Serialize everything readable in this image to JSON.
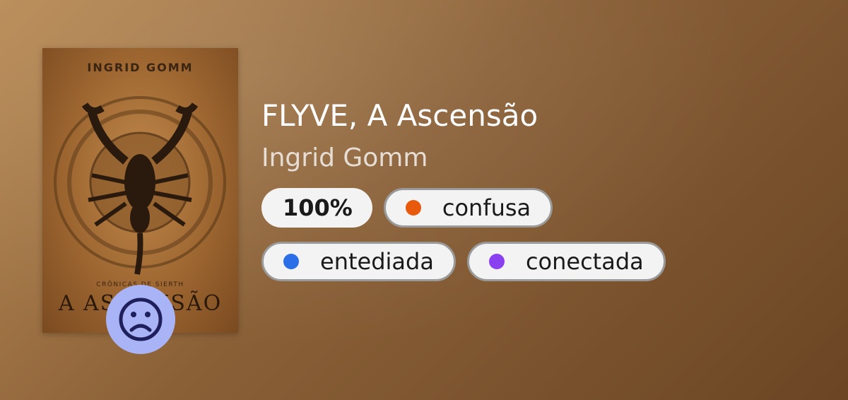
{
  "colors": {
    "background_start": "#b98b55",
    "background_end": "#6b4524",
    "mood_badge": "#a9b4f6",
    "emotion_confusa": "#e8590c",
    "emotion_entediada": "#2b6fe8",
    "emotion_conectada": "#8a3ff0"
  },
  "cover": {
    "author_text": "INGRID GOMM",
    "series_text": "CRÔNICAS DE SIERTH",
    "title_text": "A ASCENSÃO"
  },
  "book": {
    "title": "FLYVE, A Ascensão",
    "author": "Ingrid Gomm"
  },
  "mood": {
    "icon": "sad-face-icon"
  },
  "progress": {
    "label": "100%",
    "value": 100
  },
  "emotions": [
    {
      "label": "confusa",
      "color": "#e8590c"
    },
    {
      "label": "entediada",
      "color": "#2b6fe8"
    },
    {
      "label": "conectada",
      "color": "#8a3ff0"
    }
  ]
}
